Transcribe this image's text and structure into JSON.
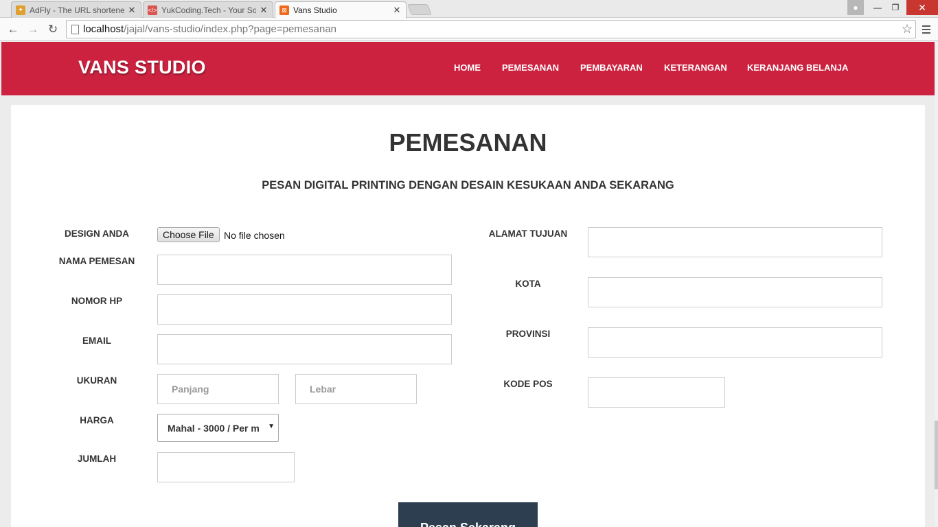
{
  "browser": {
    "tabs": [
      {
        "title": "AdFly - The URL shortener",
        "favicon": "adfly-icon"
      },
      {
        "title": "YukCoding.Tech - Your So",
        "favicon": "code-icon"
      },
      {
        "title": "Vans Studio",
        "favicon": "xampp-icon"
      }
    ],
    "url_host": "localhost",
    "url_path": "/jajal/vans-studio/index.php?page=pemesanan"
  },
  "site": {
    "brand": "VANS STUDIO",
    "nav": [
      "HOME",
      "PEMESANAN",
      "PEMBAYARAN",
      "KETERANGAN",
      "KERANJANG BELANJA"
    ],
    "title": "PEMESANAN",
    "subtitle": "PESAN DIGITAL PRINTING DENGAN DESAIN KESUKAAN ANDA SEKARANG"
  },
  "form": {
    "left": {
      "design_label": "DESIGN ANDA",
      "file_button": "Choose File",
      "file_status": "No file chosen",
      "nama_label": "NAMA PEMESAN",
      "nomor_label": "NOMOR HP",
      "email_label": "EMAIL",
      "ukuran_label": "UKURAN",
      "panjang_placeholder": "Panjang",
      "lebar_placeholder": "Lebar",
      "harga_label": "HARGA",
      "harga_selected": "Mahal - 3000 / Per m",
      "jumlah_label": "JUMLAH"
    },
    "right": {
      "alamat_label": "ALAMAT TUJUAN",
      "kota_label": "KOTA",
      "provinsi_label": "PROVINSI",
      "kodepos_label": "KODE POS"
    },
    "submit_label": "Pesan Sekarang"
  },
  "colors": {
    "header_red": "#cc2240",
    "submit_navy": "#2c3e50"
  }
}
